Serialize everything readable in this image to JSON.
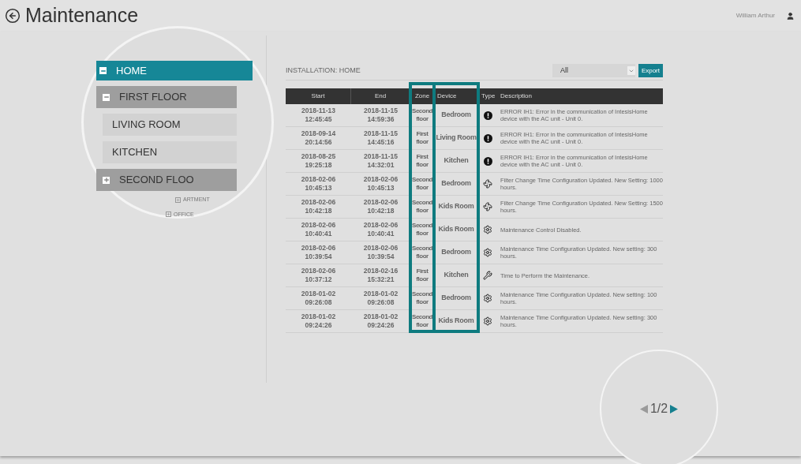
{
  "header": {
    "title": "Maintenance",
    "user": "William Arthur"
  },
  "tree": [
    {
      "label": "HOME",
      "selected": true,
      "expanded": true,
      "children": [
        {
          "label": "FIRST FLOOR",
          "selected": false,
          "expanded": true,
          "children": [
            {
              "label": "LIVING ROOM",
              "selected": false
            },
            {
              "label": "KITCHEN",
              "selected": false
            }
          ]
        },
        {
          "label": "SECOND FLOO",
          "selected": false,
          "expanded": false
        }
      ]
    }
  ],
  "tree_small": [
    {
      "label": "ARTMENT",
      "expanded": false
    },
    {
      "label": "OFFICE",
      "expanded": false
    }
  ],
  "installation": "INSTALLATION: HOME",
  "filter": {
    "value": "All"
  },
  "export_button": "Export",
  "table": {
    "columns": [
      "Start",
      "End",
      "Zone",
      "Device",
      "Type",
      "Description"
    ],
    "rows": [
      {
        "start": "2018-11-13 12:45:45",
        "end": "2018-11-15 14:59:36",
        "zone": "Second floor",
        "device": "Bedroom",
        "kind": "error",
        "description": "ERROR IH1: Error in the communication of IntesisHome device with the AC unit - Unit 0."
      },
      {
        "start": "2018-09-14 20:14:56",
        "end": "2018-11-15 14:45:16",
        "zone": "First floor",
        "device": "Living Room",
        "kind": "error",
        "description": "ERROR IH1: Error in the communication of IntesisHome device with the AC unit - Unit 0."
      },
      {
        "start": "2018-08-25 19:25:18",
        "end": "2018-11-15 14:32:01",
        "zone": "First floor",
        "device": "Kitchen",
        "kind": "error",
        "description": "ERROR IH1: Error in the communication of IntesisHome device with the AC unit - Unit 0."
      },
      {
        "start": "2018-02-06 10:45:13",
        "end": "2018-02-06 10:45:13",
        "zone": "Second floor",
        "device": "Bedroom",
        "kind": "filter",
        "description": "Filter Change Time Configuration Updated. New Setting: 1000 hours."
      },
      {
        "start": "2018-02-06 10:42:18",
        "end": "2018-02-06 10:42:18",
        "zone": "Second floor",
        "device": "Kids Room",
        "kind": "filter",
        "description": "Filter Change Time Configuration Updated. New Setting: 1500 hours."
      },
      {
        "start": "2018-02-06 10:40:41",
        "end": "2018-02-06 10:40:41",
        "zone": "Second floor",
        "device": "Kids Room",
        "kind": "maintenance",
        "description": "Maintenance Control Disabled."
      },
      {
        "start": "2018-02-06 10:39:54",
        "end": "2018-02-06 10:39:54",
        "zone": "Second floor",
        "device": "Bedroom",
        "kind": "maintenance",
        "description": "Maintenance Time Configuration Updated. New setting: 300 hours."
      },
      {
        "start": "2018-02-06 10:37:12",
        "end": "2018-02-16 15:32:21",
        "zone": "First floor",
        "device": "Kitchen",
        "kind": "wrench",
        "description": "Time to Perform the Maintenance."
      },
      {
        "start": "2018-01-02 09:26:08",
        "end": "2018-01-02 09:26:08",
        "zone": "Second floor",
        "device": "Bedroom",
        "kind": "maintenance",
        "description": "Maintenance Time Configuration Updated. New setting: 100 hours."
      },
      {
        "start": "2018-01-02 09:24:26",
        "end": "2018-01-02 09:24:26",
        "zone": "Second floor",
        "device": "Kids Room",
        "kind": "maintenance",
        "description": "Maintenance Time Configuration Updated. New setting: 300 hours."
      }
    ]
  },
  "pagination": {
    "page": "1/2",
    "prev_disabled": true,
    "next_disabled": false
  }
}
